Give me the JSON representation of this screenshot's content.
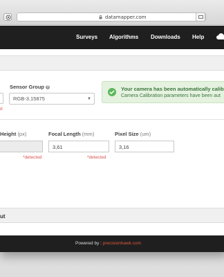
{
  "browser": {
    "url": "datamapper.com",
    "reload_glyph": "↻"
  },
  "nav": {
    "items": [
      "Surveys",
      "Algorithms",
      "Downloads",
      "Help"
    ],
    "cloud_icon": "cloud-icon"
  },
  "camera": {
    "sensor_group_label": "Sensor Group",
    "sensor_group_value": "RGB-3.15875",
    "partial_left_text": "d"
  },
  "alert": {
    "title": "Your camera has been automatically calibr",
    "message": "Camera Calibration parameters have been aut"
  },
  "fields": {
    "height_label": "Height",
    "height_unit": "(px)",
    "height_value": "",
    "focal_label": "Focal Length",
    "focal_unit": "(mm)",
    "focal_value": "3,61",
    "pixel_label": "Pixel Size",
    "pixel_unit": "(um)",
    "pixel_value": "3,16",
    "detected_text": "*detected"
  },
  "lower_section": {
    "label": "ut"
  },
  "footer": {
    "prefix": "Powered by : ",
    "brand": "precisionhawk.com"
  },
  "colors": {
    "navbar": "#1f1f1f",
    "alert_bg": "#e5f2e0",
    "alert_text": "#3c763d",
    "detected": "#d9534f",
    "brand": "#e05a3a"
  }
}
